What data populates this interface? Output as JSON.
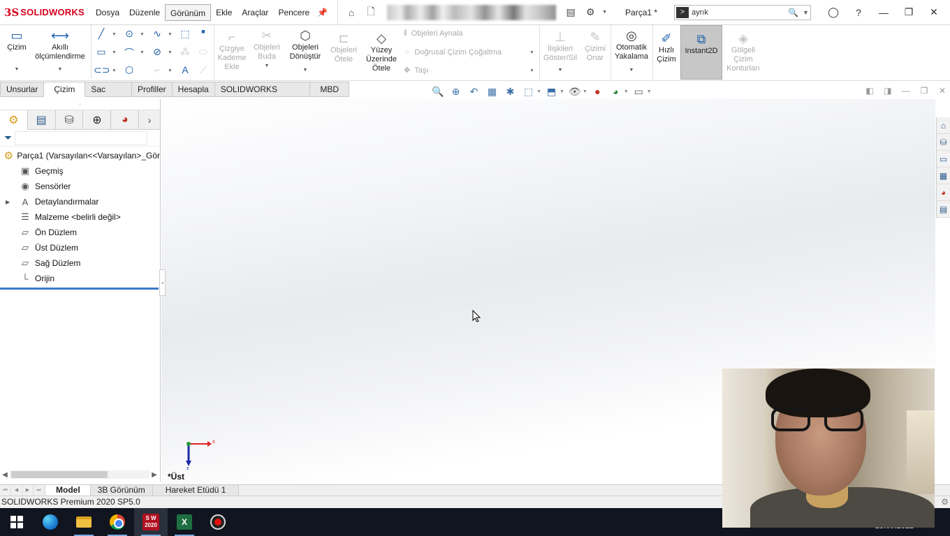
{
  "titlebar": {
    "brand_ds": "3S",
    "brand_name": "SOLIDWORKS",
    "menu": [
      "Dosya",
      "Düzenle",
      "Görünüm",
      "Ekle",
      "Araçlar",
      "Pencere"
    ],
    "active_menu": "Görünüm",
    "doc_title": "Parça1 *",
    "search_value": "ayrık",
    "search_cmd_icon": "command-prompt-icon"
  },
  "ribbon": {
    "cizim": "Çizim",
    "akilli": "Akıllı ölçümlendirme",
    "cizgiye_kademe": "Çizgiye Kademe Ekle",
    "objeleri_buda": "Objeleri Buda",
    "objeleri_donustur": "Objeleri Dönüştür",
    "objeleri_otele": "Objeleri Ötele",
    "yuzey_otele": "Yüzey Üzerinde Ötele",
    "aynala": "Objeleri Aynala",
    "dogrusal": "Doğrusal Çizim Çoğaltma",
    "tasi": "Taşı",
    "iliskiler": "İlişkileri Göster/Sil",
    "cizimi_onar": "Çizimi Onar",
    "otomatik": "Otomatik Yakalama",
    "hizli": "Hızlı Çizim",
    "instant2d": "Instant2D",
    "golgeli": "Gölgeli Çizim Konturları"
  },
  "tabs": [
    "Unsurlar",
    "Çizim",
    "Sac Levha",
    "Profiller",
    "Hesapla",
    "SOLIDWORKS Eklentileri",
    "MBD"
  ],
  "active_tab": "Çizim",
  "feature_tree": {
    "root": "Parça1  (Varsayılan<<Varsayılan>_Gör",
    "items": [
      {
        "label": "Geçmiş",
        "icon": "history-icon"
      },
      {
        "label": "Sensörler",
        "icon": "sensor-icon"
      },
      {
        "label": "Detaylandırmalar",
        "icon": "annotation-icon",
        "expandable": true
      },
      {
        "label": "Malzeme <belirli değil>",
        "icon": "material-icon"
      },
      {
        "label": "Ön Düzlem",
        "icon": "plane-icon"
      },
      {
        "label": "Üst Düzlem",
        "icon": "plane-icon"
      },
      {
        "label": "Sağ Düzlem",
        "icon": "plane-icon"
      },
      {
        "label": "Orijin",
        "icon": "origin-icon"
      }
    ]
  },
  "viewport": {
    "view_name": "*Üst",
    "triad_x": "x",
    "triad_z": "z"
  },
  "model_tabs": [
    "Model",
    "3B Görünüm",
    "Hareket Etüdü 1"
  ],
  "active_model_tab": "Model",
  "status": {
    "text": "SOLIDWORKS Premium 2020 SP5.0"
  },
  "taskbar": {
    "clock": "23.09.2022",
    "sw_label": "S W 2020",
    "excel_label": "X"
  }
}
